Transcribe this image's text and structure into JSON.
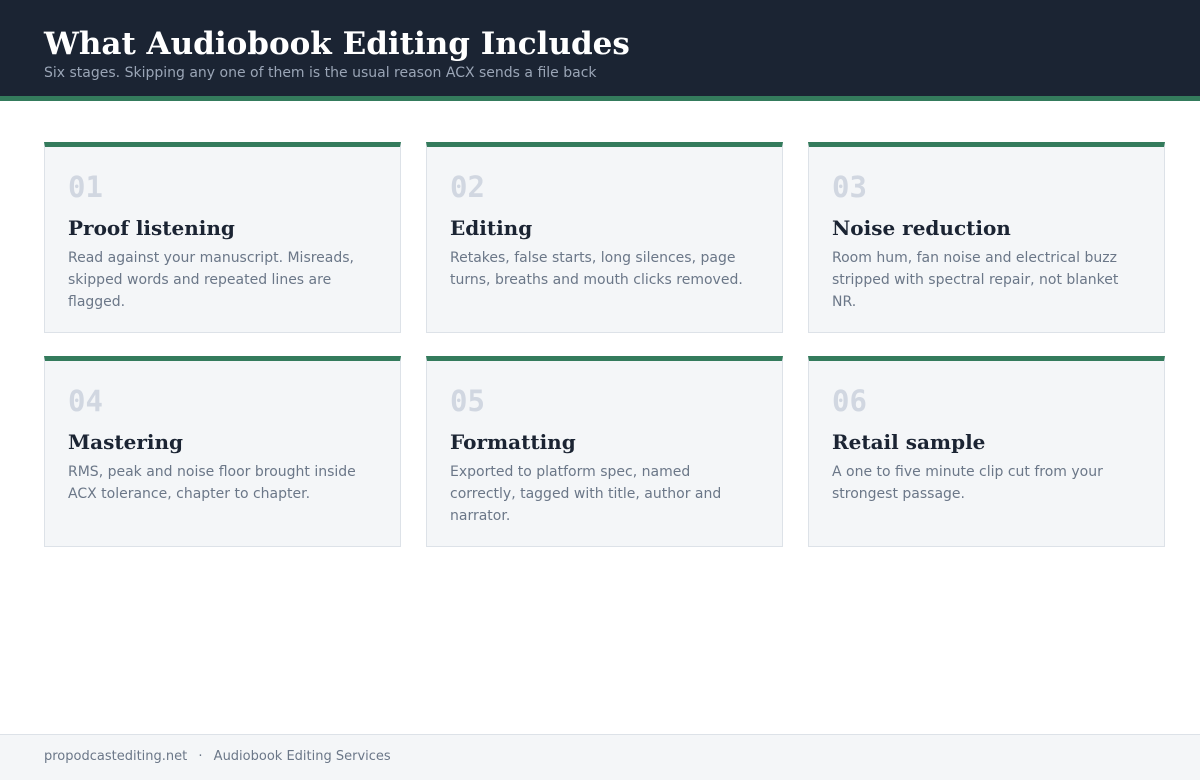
{
  "header": {
    "title": "What Audiobook Editing Includes",
    "subtitle": "Six stages. Skipping any one of them is the usual reason ACX sends a file back"
  },
  "colors": {
    "header_bg": "#1b2433",
    "accent": "#347b5c",
    "card_bg": "#f4f6f8",
    "number_color": "#d1d7e1",
    "text_muted": "#6b7788"
  },
  "stages": [
    {
      "number": "01",
      "title": "Proof listening",
      "description": "Read against your manuscript. Misreads, skipped words and repeated lines are flagged."
    },
    {
      "number": "02",
      "title": "Editing",
      "description": "Retakes, false starts, long silences, page turns, breaths and mouth clicks removed."
    },
    {
      "number": "03",
      "title": "Noise reduction",
      "description": "Room hum, fan noise and electrical buzz stripped with spectral repair, not blanket NR."
    },
    {
      "number": "04",
      "title": "Mastering",
      "description": "RMS, peak and noise floor brought inside ACX tolerance, chapter to chapter."
    },
    {
      "number": "05",
      "title": "Formatting",
      "description": "Exported to platform spec, named correctly, tagged with title, author and narrator."
    },
    {
      "number": "06",
      "title": "Retail sample",
      "description": "A one to five minute clip cut from your strongest passage."
    }
  ],
  "footer": {
    "site": "propodcastediting.net",
    "separator": "·",
    "label": "Audiobook Editing Services"
  }
}
